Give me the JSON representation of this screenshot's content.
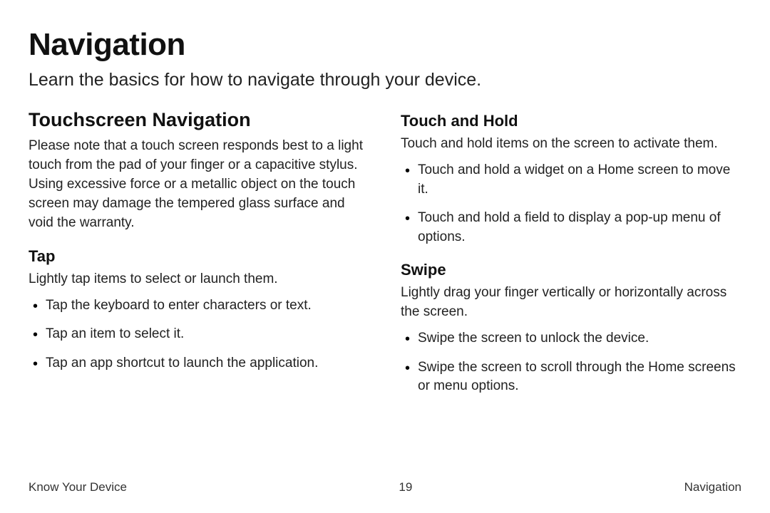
{
  "title": "Navigation",
  "intro": "Learn the basics for how to navigate through your device.",
  "left": {
    "heading": "Touchscreen Navigation",
    "paragraph": "Please note that a touch screen responds best to a light touch from the pad of your finger or a capacitive stylus. Using excessive force or a metallic object on the touch screen may damage the tempered glass surface and void the warranty.",
    "sub_heading": "Tap",
    "sub_intro": "Lightly tap items to select or launch them.",
    "bullets": [
      "Tap the keyboard to enter characters or text.",
      "Tap an item to select it.",
      "Tap an app shortcut to launch the application."
    ]
  },
  "right": {
    "sec1_heading": "Touch and Hold",
    "sec1_intro": "Touch and hold items on the screen to activate them.",
    "sec1_bullets": [
      "Touch and hold a widget on a Home screen to move it.",
      "Touch and hold a field to display a pop-up menu of options."
    ],
    "sec2_heading": "Swipe",
    "sec2_intro": "Lightly drag your finger vertically or horizontally across the screen.",
    "sec2_bullets": [
      "Swipe the screen to unlock the device.",
      "Swipe the screen to scroll through the Home screens or menu options."
    ]
  },
  "footer": {
    "left": "Know Your Device",
    "center": "19",
    "right": "Navigation"
  }
}
